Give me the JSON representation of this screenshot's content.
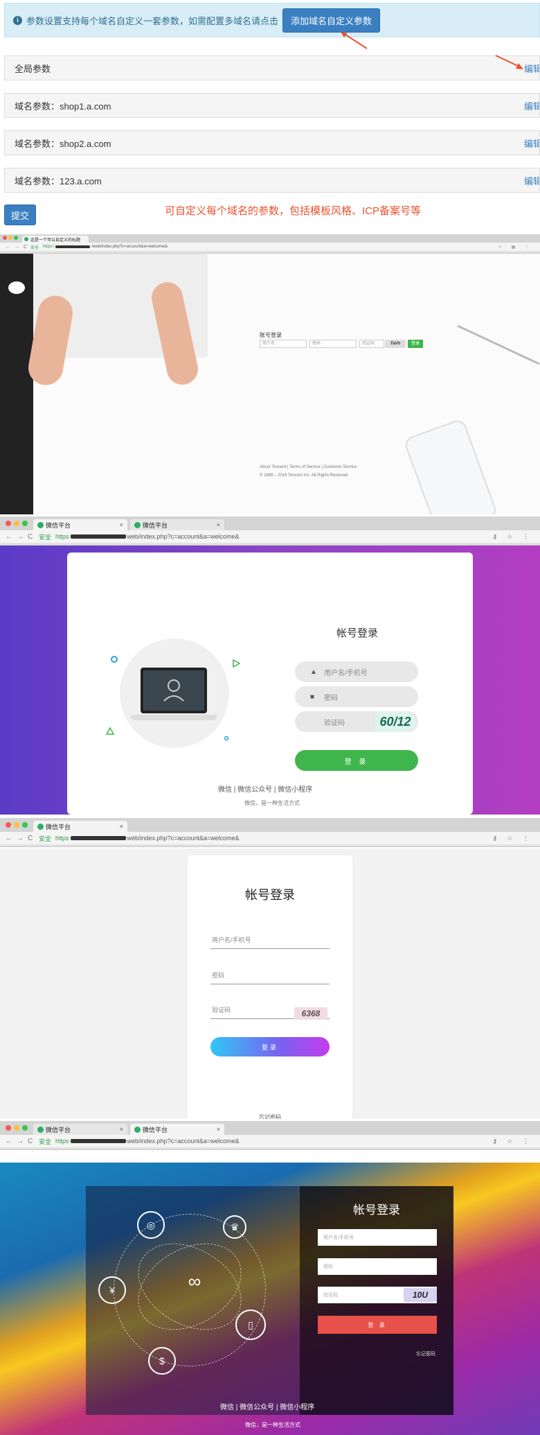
{
  "settings": {
    "info_text": "参数设置支持每个域名自定义一套参数，如需配置多域名请点击",
    "add_button": "添加域名自定义参数",
    "rows": [
      {
        "label": "全局参数",
        "action": "编辑"
      },
      {
        "label": "域名参数：shop1.a.com",
        "action": "编辑"
      },
      {
        "label": "域名参数：shop2.a.com",
        "action": "编辑"
      },
      {
        "label": "域名参数：123.a.com",
        "action": "编辑"
      }
    ],
    "submit": "提交",
    "note": "可自定义每个域名的参数，包括模板风格、ICP备案号等"
  },
  "colors": {
    "info_bg": "#d9edf7",
    "primary": "#3a7fc1",
    "note_red": "#e8532f",
    "wechat_green": "#3fb54b",
    "login_red": "#e8504a"
  },
  "shot1": {
    "tab": "这是一个可以自定义的标题",
    "url_safe": "安全",
    "url_https": "https:/",
    "url_path": "/web/index.php?c=account&a=welcome&",
    "login_title": "账号登录",
    "user_ph": "用户名",
    "pwd_ph": "密码",
    "captcha_ph": "验证码",
    "captcha_text": "TaVh",
    "login_btn": "登录",
    "footer_links": "About Tencent  |  Terms of Service  |  Customer Service",
    "copyright": "© 1998 – 2016 Tencent Inc. All Rights Reserved"
  },
  "shot2": {
    "tab1": "微信平台",
    "tab2": "微信平台",
    "url_safe": "安全",
    "url_https": "https",
    "url_path": "web/index.php?c=account&a=welcome&",
    "title": "帐号登录",
    "user_ph": "用户名/手机号",
    "pwd_ph": "密码",
    "captcha_ph": "验证码",
    "captcha_text": "60/12",
    "login_btn": "登 录",
    "links": "微信  |  微信公众号  |  微信小程序",
    "slogan": "微信，是一种生活方式"
  },
  "shot3": {
    "tab": "微信平台",
    "url_safe": "安全",
    "url_https": "https",
    "url_path": "web/index.php?c=account&a=welcome&",
    "title": "帐号登录",
    "user_ph": "用户名/手机号",
    "pwd_ph": "密码",
    "captcha_ph": "验证码",
    "captcha_text": "6368",
    "login_btn": "登录",
    "forgot": "忘记密码"
  },
  "shot4": {
    "tab1": "微信平台",
    "tab2": "微信平台",
    "url_safe": "安全",
    "url_https": "https",
    "url_path": "web/index.php?c=account&a=welcome&",
    "title": "帐号登录",
    "user_ph": "用户名/手机号",
    "pwd_ph": "密码",
    "captcha_ph": "验证码",
    "captcha_text": "10U",
    "login_btn": "登 录",
    "forgot": "忘记密码",
    "links": "微信  |  微信公众号  |  微信小程序",
    "slogan": "微信，是一种生活方式"
  }
}
